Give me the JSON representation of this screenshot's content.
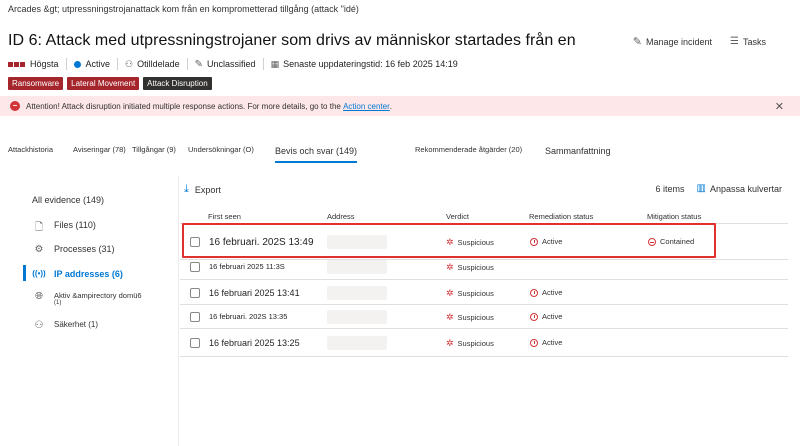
{
  "breadcrumb": "Arcades &gt; utpressningstrojanattack kom från en komprometterad tillgång (attack \"idé)",
  "page_title": "ID 6: Attack med utpressningstrojaner som drivs av människor startades från en",
  "top_actions": {
    "manage": "Manage incident",
    "tasks": "Tasks"
  },
  "meta": {
    "severity": "Högsta",
    "status": "Active",
    "assigned": "Otilldelade",
    "classification": "Unclassified",
    "last_update": "Senaste uppdateringstid: 16 feb 2025 14:19"
  },
  "tags": [
    {
      "label": "Ransomware",
      "color": "#a4262c"
    },
    {
      "label": "Lateral Movement",
      "color": "#a4262c"
    },
    {
      "label": "Attack Disruption",
      "color": "#323130"
    }
  ],
  "banner": {
    "text": "Attention! Attack disruption initiated multiple response actions. For more details, go to the",
    "link": "Action center",
    "suffix": "."
  },
  "tabs": [
    "Attackhistoria",
    "Aviseringar (78)",
    "Tillgångar (9)",
    "Undersökningar (O)",
    "Bevis och svar (149)",
    "Rekommenderade åtgärder (20)",
    "Sammanfattning"
  ],
  "left_nav": {
    "all": "All evidence (149)",
    "items": [
      {
        "label": "Files (110)",
        "icon": "file-icon"
      },
      {
        "label": "Processes (31)",
        "icon": "gear-icon"
      },
      {
        "label": "IP addresses (6)",
        "icon": "broadcast-icon"
      },
      {
        "label": "Aktiv &ampirectory domü6",
        "sub": "(1)",
        "icon": "globe-icon"
      },
      {
        "label": "Säkerhet (1)",
        "icon": "users-icon"
      }
    ]
  },
  "toolbar": {
    "export": "Export",
    "count": "6 items",
    "customize": "Anpassa kulvertar"
  },
  "table": {
    "headers": [
      "First seen",
      "Address",
      "Verdict",
      "Remediation status",
      "Mitigation status"
    ],
    "rows": [
      {
        "first_seen": "16 februari. 202S 13:49",
        "verdict": "Suspicious",
        "remediation": "Active",
        "mitigation": "Contained"
      },
      {
        "first_seen": "16 februari 2025 11:3S",
        "verdict": "Suspicious",
        "remediation": "",
        "mitigation": ""
      },
      {
        "first_seen": "16 februari 2025 13:41",
        "verdict": "Suspicious",
        "remediation": "Active",
        "mitigation": ""
      },
      {
        "first_seen": "16 februari. 202S 13:35",
        "verdict": "Suspicious",
        "remediation": "Active",
        "mitigation": ""
      },
      {
        "first_seen": "16 februari 2025 13:25",
        "verdict": "Suspicious",
        "remediation": "Active",
        "mitigation": ""
      }
    ]
  },
  "colors": {
    "accent": "#0078d4",
    "danger": "#d13438",
    "highlight": "#e0312e"
  }
}
